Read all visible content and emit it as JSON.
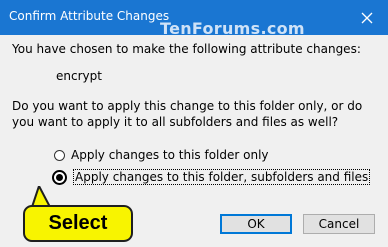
{
  "window": {
    "title": "Confirm Attribute Changes",
    "watermark": "TenForums.com"
  },
  "dialog": {
    "intro": "You have chosen to make the following attribute changes:",
    "attribute": "encrypt",
    "question": "Do you want to apply this change to this folder only, or do you want to apply it to all subfolders and files as well?",
    "options": [
      {
        "label": "Apply changes to this folder only",
        "selected": false
      },
      {
        "label": "Apply changes to this folder, subfolders and files",
        "selected": true
      }
    ]
  },
  "buttons": {
    "ok": "OK",
    "cancel": "Cancel"
  },
  "callout": {
    "text": "Select"
  },
  "colors": {
    "titlebar": "#1a76d2",
    "callout": "#f8f400",
    "accent": "#0078d7"
  }
}
